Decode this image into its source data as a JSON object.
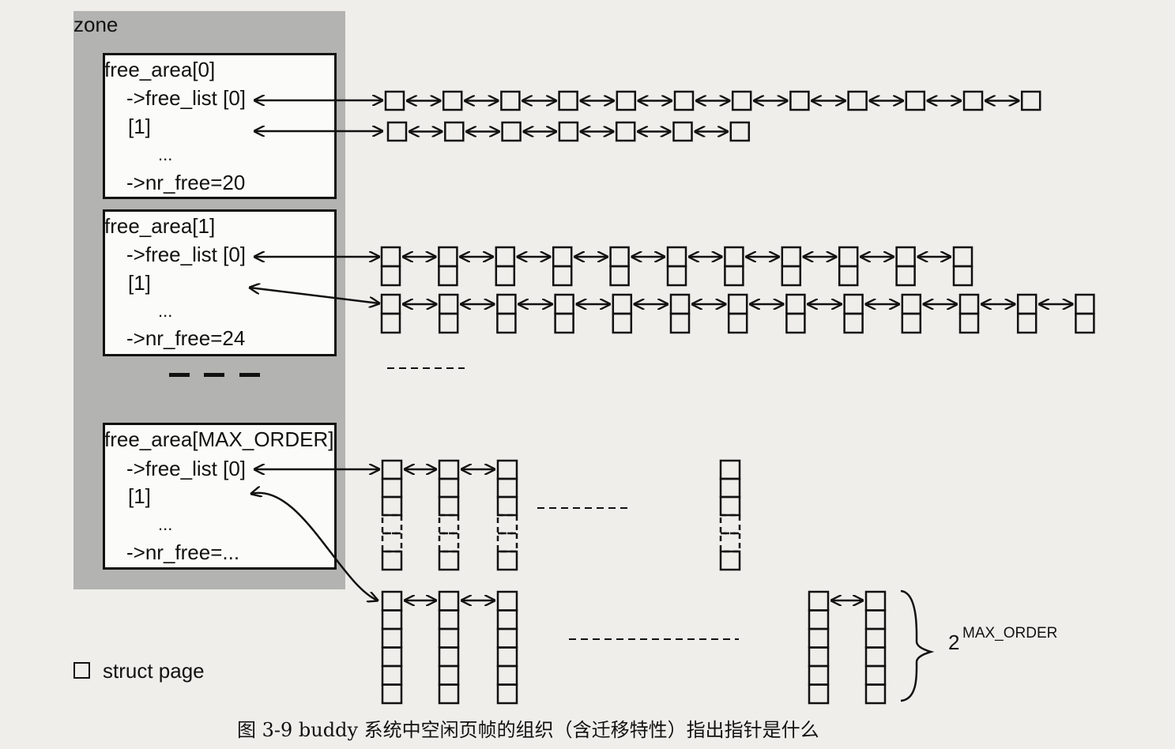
{
  "zone": {
    "label": "zone"
  },
  "free_areas": [
    {
      "title": "free_area[0]",
      "free_list_label": "->free_list [0]",
      "second_list_label": "[1]",
      "ellipsis": "...",
      "nr_free": "->nr_free=20"
    },
    {
      "title": "free_area[1]",
      "free_list_label": "->free_list [0]",
      "second_list_label": "[1]",
      "ellipsis": "...",
      "nr_free": "->nr_free=24"
    },
    {
      "title": "free_area[MAX_ORDER]",
      "free_list_label": "->free_list [0]",
      "second_list_label": "[1]",
      "ellipsis": "...",
      "nr_free": "->nr_free=..."
    }
  ],
  "legend": {
    "label": "struct page",
    "icon": "square-icon"
  },
  "max_order_label": {
    "base": "2",
    "exponent": "MAX_ORDER"
  },
  "caption": "图 3-9   buddy 系统中空闲页帧的组织（含迁移特性）指出指针是什么",
  "colors": {
    "zone_panel": "#b3b3b1",
    "ink": "#111111",
    "box_fill": "#fbfbf9",
    "background": "#efeeea"
  },
  "diagram": {
    "order0_list0_blocks": 12,
    "order0_list1_blocks": 7,
    "order1_list0_blocks": 11,
    "order1_list1_blocks": 13,
    "max_order_list0_blocks": 4,
    "max_order_list1_blocks": 5
  }
}
